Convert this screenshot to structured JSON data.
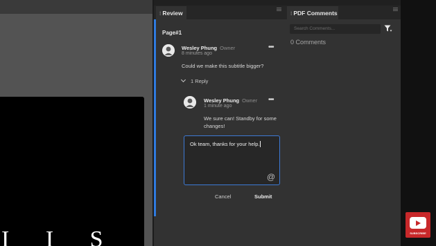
{
  "document": {
    "visible_text": "I I S"
  },
  "review_panel": {
    "tab_label": "Review",
    "page_label": "Page#1",
    "comment": {
      "author": "Wesley Phung",
      "role": "Owner",
      "time": "8 minutes ago",
      "text": "Could we make this subtitle bigger?",
      "more": "•••"
    },
    "replies_toggle": "1 Reply",
    "reply": {
      "author": "Wesley Phung",
      "role": "Owner",
      "time": "1 minute ago",
      "text": "We sure can! Standby for some changes!",
      "more": "•••"
    },
    "reply_input": {
      "value": "Ok team, thanks for your help.",
      "mention_symbol": "@"
    },
    "cancel_label": "Cancel",
    "submit_label": "Submit"
  },
  "pdf_comments_panel": {
    "tab_label": "PDF Comments",
    "search_placeholder": "Search Comments...",
    "count_text": "0 Comments"
  },
  "subscribe_badge": {
    "label": "SUBSCRIBE",
    "color": "#c8282a"
  },
  "colors": {
    "accent": "#2f7be0",
    "panel": "#323232"
  }
}
